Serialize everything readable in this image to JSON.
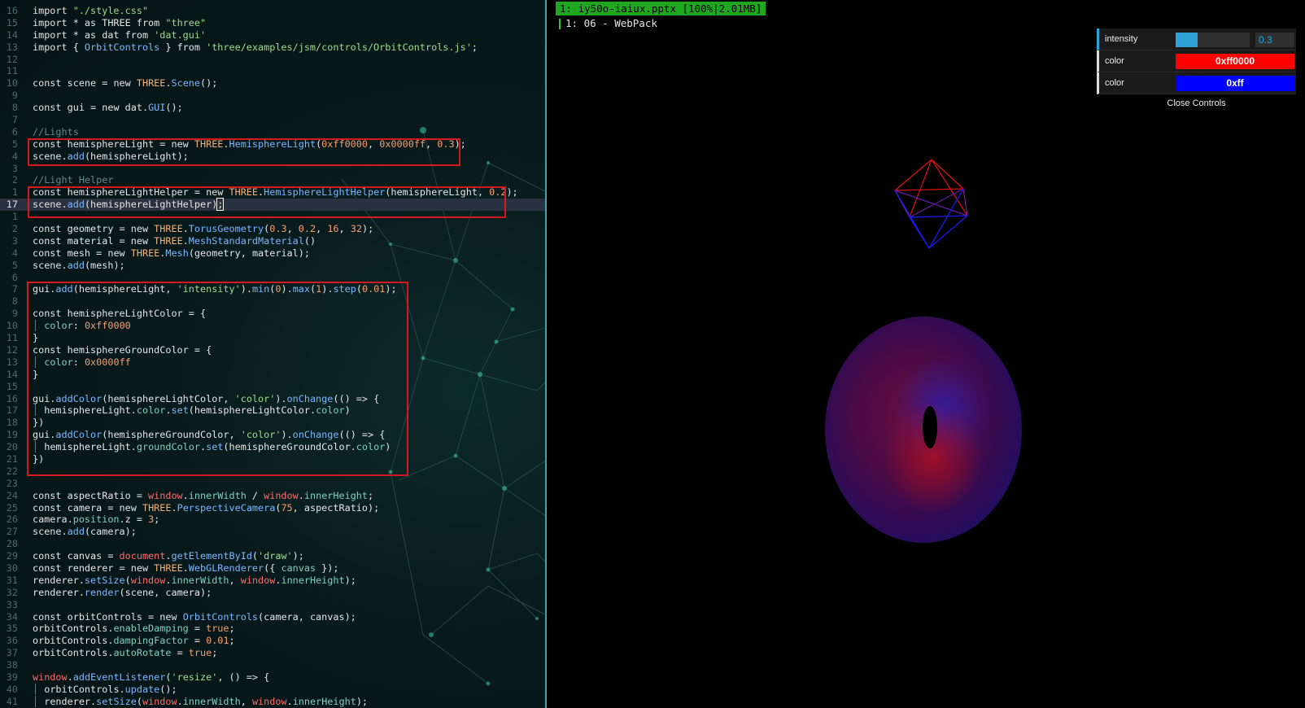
{
  "editor": {
    "lines": [
      {
        "num": "16",
        "segs": [
          [
            "import ",
            "k"
          ],
          [
            "\"./style.css\"",
            "s"
          ]
        ]
      },
      {
        "num": "15",
        "segs": [
          [
            "import * as THREE from ",
            "k"
          ],
          [
            "\"three\"",
            "s"
          ]
        ]
      },
      {
        "num": "14",
        "segs": [
          [
            "import * as dat from ",
            "k"
          ],
          [
            "'dat.gui'",
            "s"
          ]
        ]
      },
      {
        "num": "13",
        "segs": [
          [
            "import { ",
            "k"
          ],
          [
            "OrbitControls",
            "f"
          ],
          [
            " } from ",
            "k"
          ],
          [
            "'three/examples/jsm/controls/OrbitControls.js'",
            "s"
          ],
          [
            ";",
            "k"
          ]
        ]
      },
      {
        "num": "12",
        "segs": []
      },
      {
        "num": "11",
        "segs": []
      },
      {
        "num": "10",
        "segs": [
          [
            "const scene = ",
            "k"
          ],
          [
            "new ",
            "k"
          ],
          [
            "THREE",
            "t"
          ],
          [
            ".",
            "k"
          ],
          [
            "Scene",
            "f"
          ],
          [
            "();",
            "k"
          ]
        ]
      },
      {
        "num": "9",
        "segs": []
      },
      {
        "num": "8",
        "segs": [
          [
            "const gui = ",
            "k"
          ],
          [
            "new ",
            "k"
          ],
          [
            "dat",
            "k"
          ],
          [
            ".",
            "k"
          ],
          [
            "GUI",
            "f"
          ],
          [
            "();",
            "k"
          ]
        ]
      },
      {
        "num": "7",
        "segs": []
      },
      {
        "num": "6",
        "segs": [
          [
            "//Lights",
            "c"
          ]
        ]
      },
      {
        "num": "5",
        "segs": [
          [
            "const hemisphereLight = ",
            "k"
          ],
          [
            "new ",
            "k"
          ],
          [
            "THREE",
            "t"
          ],
          [
            ".",
            "k"
          ],
          [
            "HemisphereLight",
            "f"
          ],
          [
            "(",
            "k"
          ],
          [
            "0xff0000",
            "n"
          ],
          [
            ", ",
            "k"
          ],
          [
            "0x0000ff",
            "n"
          ],
          [
            ", ",
            "k"
          ],
          [
            "0.3",
            "n"
          ],
          [
            ");",
            "k"
          ]
        ]
      },
      {
        "num": "4",
        "segs": [
          [
            "scene.",
            "k"
          ],
          [
            "add",
            "f"
          ],
          [
            "(hemisphereLight);",
            "k"
          ]
        ]
      },
      {
        "num": "3",
        "segs": []
      },
      {
        "num": "2",
        "segs": [
          [
            "//Light Helper",
            "c"
          ]
        ]
      },
      {
        "num": "1",
        "segs": [
          [
            "const hemisphereLightHelper = ",
            "k"
          ],
          [
            "new ",
            "k"
          ],
          [
            "THREE",
            "t"
          ],
          [
            ".",
            "k"
          ],
          [
            "HemisphereLightHelper",
            "f"
          ],
          [
            "(hemisphereLight, ",
            "k"
          ],
          [
            "0.2",
            "n"
          ],
          [
            ");",
            "k"
          ]
        ]
      },
      {
        "num": "17",
        "current": true,
        "segs": [
          [
            "scene.",
            "k"
          ],
          [
            "add",
            "f"
          ],
          [
            "(hemisphereLightHelper)",
            "k"
          ],
          [
            ";",
            "cursor"
          ]
        ]
      },
      {
        "num": "1",
        "segs": []
      },
      {
        "num": "2",
        "segs": [
          [
            "const geometry = ",
            "k"
          ],
          [
            "new ",
            "k"
          ],
          [
            "THREE",
            "t"
          ],
          [
            ".",
            "k"
          ],
          [
            "TorusGeometry",
            "f"
          ],
          [
            "(",
            "k"
          ],
          [
            "0.3",
            "n"
          ],
          [
            ", ",
            "k"
          ],
          [
            "0.2",
            "n"
          ],
          [
            ", ",
            "k"
          ],
          [
            "16",
            "n"
          ],
          [
            ", ",
            "k"
          ],
          [
            "32",
            "n"
          ],
          [
            ");",
            "k"
          ]
        ]
      },
      {
        "num": "3",
        "segs": [
          [
            "const material = ",
            "k"
          ],
          [
            "new ",
            "k"
          ],
          [
            "THREE",
            "t"
          ],
          [
            ".",
            "k"
          ],
          [
            "MeshStandardMaterial",
            "f"
          ],
          [
            "()",
            "k"
          ]
        ]
      },
      {
        "num": "4",
        "segs": [
          [
            "const mesh = ",
            "k"
          ],
          [
            "new ",
            "k"
          ],
          [
            "THREE",
            "t"
          ],
          [
            ".",
            "k"
          ],
          [
            "Mesh",
            "f"
          ],
          [
            "(geometry, material);",
            "k"
          ]
        ]
      },
      {
        "num": "5",
        "segs": [
          [
            "scene.",
            "k"
          ],
          [
            "add",
            "f"
          ],
          [
            "(mesh);",
            "k"
          ]
        ]
      },
      {
        "num": "6",
        "segs": []
      },
      {
        "num": "7",
        "segs": [
          [
            "gui.",
            "k"
          ],
          [
            "add",
            "f"
          ],
          [
            "(hemisphereLight, ",
            "k"
          ],
          [
            "'intensity'",
            "s"
          ],
          [
            ").",
            "k"
          ],
          [
            "min",
            "f"
          ],
          [
            "(",
            "k"
          ],
          [
            "0",
            "n"
          ],
          [
            ").",
            "k"
          ],
          [
            "max",
            "f"
          ],
          [
            "(",
            "k"
          ],
          [
            "1",
            "n"
          ],
          [
            ").",
            "k"
          ],
          [
            "step",
            "f"
          ],
          [
            "(",
            "k"
          ],
          [
            "0.01",
            "n"
          ],
          [
            ");",
            "k"
          ]
        ]
      },
      {
        "num": "8",
        "segs": []
      },
      {
        "num": "9",
        "segs": [
          [
            "const hemisphereLightColor = {",
            "k"
          ]
        ]
      },
      {
        "num": "10",
        "segs": [
          [
            "│ ",
            "c"
          ],
          [
            "color",
            "p"
          ],
          [
            ": ",
            "k"
          ],
          [
            "0xff0000",
            "n"
          ]
        ]
      },
      {
        "num": "11",
        "segs": [
          [
            "}",
            "k"
          ]
        ]
      },
      {
        "num": "12",
        "segs": [
          [
            "const hemisphereGroundColor = {",
            "k"
          ]
        ]
      },
      {
        "num": "13",
        "segs": [
          [
            "│ ",
            "c"
          ],
          [
            "color",
            "p"
          ],
          [
            ": ",
            "k"
          ],
          [
            "0x0000ff",
            "n"
          ]
        ]
      },
      {
        "num": "14",
        "segs": [
          [
            "}",
            "k"
          ]
        ]
      },
      {
        "num": "15",
        "segs": []
      },
      {
        "num": "16",
        "segs": [
          [
            "gui.",
            "k"
          ],
          [
            "addColor",
            "f"
          ],
          [
            "(hemisphereLightColor, ",
            "k"
          ],
          [
            "'color'",
            "s"
          ],
          [
            ").",
            "k"
          ],
          [
            "onChange",
            "f"
          ],
          [
            "(() => {",
            "k"
          ]
        ]
      },
      {
        "num": "17",
        "segs": [
          [
            "│ ",
            "c"
          ],
          [
            "hemisphereLight.",
            "k"
          ],
          [
            "color",
            "p"
          ],
          [
            ".",
            "k"
          ],
          [
            "set",
            "f"
          ],
          [
            "(hemisphereLightColor.",
            "k"
          ],
          [
            "color",
            "p"
          ],
          [
            ")",
            "k"
          ]
        ]
      },
      {
        "num": "18",
        "segs": [
          [
            "})",
            "k"
          ]
        ]
      },
      {
        "num": "19",
        "segs": [
          [
            "gui.",
            "k"
          ],
          [
            "addColor",
            "f"
          ],
          [
            "(hemisphereGroundColor, ",
            "k"
          ],
          [
            "'color'",
            "s"
          ],
          [
            ").",
            "k"
          ],
          [
            "onChange",
            "f"
          ],
          [
            "(() => {",
            "k"
          ]
        ]
      },
      {
        "num": "20",
        "segs": [
          [
            "│ ",
            "c"
          ],
          [
            "hemisphereLight.",
            "k"
          ],
          [
            "groundColor",
            "p"
          ],
          [
            ".",
            "k"
          ],
          [
            "set",
            "f"
          ],
          [
            "(hemisphereGroundColor.",
            "k"
          ],
          [
            "color",
            "p"
          ],
          [
            ")",
            "k"
          ]
        ]
      },
      {
        "num": "21",
        "segs": [
          [
            "})",
            "k"
          ]
        ]
      },
      {
        "num": "22",
        "segs": []
      },
      {
        "num": "23",
        "segs": []
      },
      {
        "num": "24",
        "segs": [
          [
            "const aspectRatio = ",
            "k"
          ],
          [
            "window",
            "r"
          ],
          [
            ".",
            "k"
          ],
          [
            "innerWidth",
            "p"
          ],
          [
            " / ",
            "k"
          ],
          [
            "window",
            "r"
          ],
          [
            ".",
            "k"
          ],
          [
            "innerHeight",
            "p"
          ],
          [
            ";",
            "k"
          ]
        ]
      },
      {
        "num": "25",
        "segs": [
          [
            "const camera = ",
            "k"
          ],
          [
            "new ",
            "k"
          ],
          [
            "THREE",
            "t"
          ],
          [
            ".",
            "k"
          ],
          [
            "PerspectiveCamera",
            "f"
          ],
          [
            "(",
            "k"
          ],
          [
            "75",
            "n"
          ],
          [
            ", aspectRatio);",
            "k"
          ]
        ]
      },
      {
        "num": "26",
        "segs": [
          [
            "camera.",
            "k"
          ],
          [
            "position",
            "p"
          ],
          [
            ".z = ",
            "k"
          ],
          [
            "3",
            "n"
          ],
          [
            ";",
            "k"
          ]
        ]
      },
      {
        "num": "27",
        "segs": [
          [
            "scene.",
            "k"
          ],
          [
            "add",
            "f"
          ],
          [
            "(camera);",
            "k"
          ]
        ]
      },
      {
        "num": "28",
        "segs": []
      },
      {
        "num": "29",
        "segs": [
          [
            "const canvas = ",
            "k"
          ],
          [
            "document",
            "r"
          ],
          [
            ".",
            "k"
          ],
          [
            "getElementById",
            "f"
          ],
          [
            "(",
            "k"
          ],
          [
            "'draw'",
            "s"
          ],
          [
            ");",
            "k"
          ]
        ]
      },
      {
        "num": "30",
        "segs": [
          [
            "const renderer = ",
            "k"
          ],
          [
            "new ",
            "k"
          ],
          [
            "THREE",
            "t"
          ],
          [
            ".",
            "k"
          ],
          [
            "WebGLRenderer",
            "f"
          ],
          [
            "({ ",
            "k"
          ],
          [
            "canvas",
            "p"
          ],
          [
            " });",
            "k"
          ]
        ]
      },
      {
        "num": "31",
        "segs": [
          [
            "renderer.",
            "k"
          ],
          [
            "setSize",
            "f"
          ],
          [
            "(",
            "k"
          ],
          [
            "window",
            "r"
          ],
          [
            ".",
            "k"
          ],
          [
            "innerWidth",
            "p"
          ],
          [
            ", ",
            "k"
          ],
          [
            "window",
            "r"
          ],
          [
            ".",
            "k"
          ],
          [
            "innerHeight",
            "p"
          ],
          [
            ");",
            "k"
          ]
        ]
      },
      {
        "num": "32",
        "segs": [
          [
            "renderer.",
            "k"
          ],
          [
            "render",
            "f"
          ],
          [
            "(scene, camera);",
            "k"
          ]
        ]
      },
      {
        "num": "33",
        "segs": []
      },
      {
        "num": "34",
        "segs": [
          [
            "const orbitControls = ",
            "k"
          ],
          [
            "new ",
            "k"
          ],
          [
            "OrbitControls",
            "f"
          ],
          [
            "(camera, canvas);",
            "k"
          ]
        ]
      },
      {
        "num": "35",
        "segs": [
          [
            "orbitControls.",
            "k"
          ],
          [
            "enableDamping",
            "p"
          ],
          [
            " = ",
            "k"
          ],
          [
            "true",
            "n"
          ],
          [
            ";",
            "k"
          ]
        ]
      },
      {
        "num": "36",
        "segs": [
          [
            "orbitControls.",
            "k"
          ],
          [
            "dampingFactor",
            "p"
          ],
          [
            " = ",
            "k"
          ],
          [
            "0.01",
            "n"
          ],
          [
            ";",
            "k"
          ]
        ]
      },
      {
        "num": "37",
        "segs": [
          [
            "orbitControls.",
            "k"
          ],
          [
            "autoRotate",
            "p"
          ],
          [
            " = ",
            "k"
          ],
          [
            "true",
            "n"
          ],
          [
            ";",
            "k"
          ]
        ]
      },
      {
        "num": "38",
        "segs": []
      },
      {
        "num": "39",
        "segs": [
          [
            "window",
            "r"
          ],
          [
            ".",
            "k"
          ],
          [
            "addEventListener",
            "f"
          ],
          [
            "(",
            "k"
          ],
          [
            "'resize'",
            "s"
          ],
          [
            ", () => {",
            "k"
          ]
        ]
      },
      {
        "num": "40",
        "segs": [
          [
            "│ ",
            "c"
          ],
          [
            "orbitControls.",
            "k"
          ],
          [
            "update",
            "f"
          ],
          [
            "();",
            "k"
          ]
        ]
      },
      {
        "num": "41",
        "segs": [
          [
            "│ ",
            "c"
          ],
          [
            "renderer.",
            "k"
          ],
          [
            "setSize",
            "f"
          ],
          [
            "(",
            "k"
          ],
          [
            "window",
            "r"
          ],
          [
            ".",
            "k"
          ],
          [
            "innerWidth",
            "p"
          ],
          [
            ", ",
            "k"
          ],
          [
            "window",
            "r"
          ],
          [
            ".",
            "k"
          ],
          [
            "innerHeight",
            "p"
          ],
          [
            ");",
            "k"
          ]
        ]
      }
    ],
    "colors": {
      "highlight_box": "#d41a1a",
      "divider": "#3fa7a5"
    }
  },
  "viewer": {
    "title": "1: iy50o-iaiux.pptx [100%|2.01MB]",
    "tab": "1: 06 - WebPack",
    "title_bg": "#1fa81f"
  },
  "gui": {
    "intensity": {
      "label": "intensity",
      "value": "0.3",
      "fraction": 0.3
    },
    "sky_color": {
      "label": "color",
      "value": "0xff0000",
      "hex": "#ff0000"
    },
    "ground_color": {
      "label": "color",
      "value": "0xff",
      "hex": "#0000ff"
    },
    "close_label": "Close Controls"
  },
  "scene": {
    "objects": [
      "hemisphere-light-helper",
      "torus-mesh"
    ],
    "sky_color": "#ff0000",
    "ground_color": "#0000ff"
  }
}
